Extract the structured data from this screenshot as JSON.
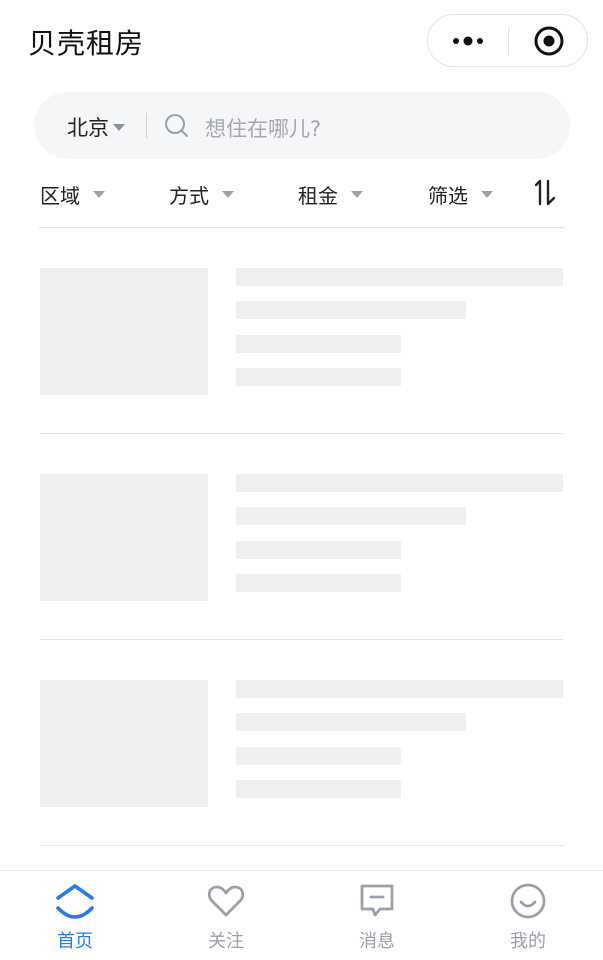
{
  "header": {
    "title": "贝壳租房",
    "capsule": {
      "more_icon": "more-dots-icon",
      "close_icon": "target-circle-icon"
    }
  },
  "search": {
    "city": "北京",
    "placeholder": "想住在哪儿?",
    "icon": "search-icon"
  },
  "filters": {
    "items": [
      {
        "label": "区域"
      },
      {
        "label": "方式"
      },
      {
        "label": "租金"
      },
      {
        "label": "筛选"
      }
    ],
    "sort_icon": "sort-arrows-icon"
  },
  "listing": {
    "loading": true,
    "placeholder_cards": 3
  },
  "tabbar": {
    "items": [
      {
        "label": "首页",
        "icon": "home-icon",
        "active": true
      },
      {
        "label": "关注",
        "icon": "heart-icon",
        "active": false
      },
      {
        "label": "消息",
        "icon": "message-icon",
        "active": false
      },
      {
        "label": "我的",
        "icon": "profile-smile-icon",
        "active": false
      }
    ]
  },
  "colors": {
    "accent": "#2a7ae2",
    "inactive_tab": "#9aa0a8",
    "skeleton": "#efefef",
    "search_bg": "#f5f6f7"
  }
}
